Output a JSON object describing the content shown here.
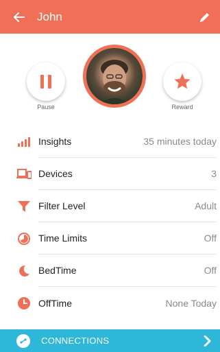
{
  "header": {
    "title": "John",
    "back_icon": "arrow-left-icon",
    "edit_icon": "pencil-icon"
  },
  "profile": {
    "pause_label": "Pause",
    "reward_label": "Reward",
    "accent": "#ef7056"
  },
  "settings": {
    "items": [
      {
        "label": "Insights",
        "value": "35 minutes today",
        "icon": "bar-chart-icon"
      },
      {
        "label": "Devices",
        "value": "3",
        "icon": "devices-icon"
      },
      {
        "label": "Filter Level",
        "value": "Adult",
        "icon": "filter-icon"
      },
      {
        "label": "Time Limits",
        "value": "Off",
        "icon": "timer-icon"
      },
      {
        "label": "BedTime",
        "value": "Off",
        "icon": "moon-icon"
      },
      {
        "label": "OffTime",
        "value": "None Today",
        "icon": "clock-icon"
      }
    ]
  },
  "footer": {
    "label": "CONNECTIONS",
    "color": "#2fb7d9"
  }
}
